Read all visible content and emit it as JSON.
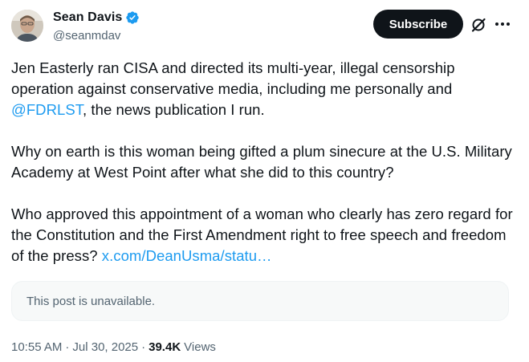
{
  "author": {
    "display_name": "Sean Davis",
    "handle": "@seanmdav",
    "verified": true
  },
  "actions": {
    "subscribe_label": "Subscribe"
  },
  "tweet": {
    "p1_text": "Jen Easterly ran CISA and directed its multi-year, illegal censorship operation against conservative media, including me personally and ",
    "p1_mention": "@FDRLST",
    "p1_tail": ", the news publication I run.",
    "p2": "Why on earth is this woman being gifted a plum sinecure at the U.S. Military Academy at West Point after what she did to this country?",
    "p3_text": "Who approved this appointment of a woman who clearly has zero regard for the Constitution and the First Amendment right to free speech and freedom of the press? ",
    "p3_link": "x.com/DeanUsma/statu…"
  },
  "quote": {
    "unavailable_text": "This post is unavailable."
  },
  "meta": {
    "time": "10:55 AM",
    "separator1": "·",
    "date": "Jul 30, 2025",
    "separator2": "·",
    "views_count": "39.4K",
    "views_label": "Views"
  },
  "colors": {
    "link": "#1d9bf0",
    "verified_badge": "#1d9bf0",
    "text_primary": "#0f1419",
    "text_secondary": "#536471",
    "button_bg": "#0f1419"
  },
  "icons": {
    "avatar": "profile-photo",
    "verified": "verified-badge-icon",
    "grok": "grok-icon",
    "more": "more-options-icon"
  }
}
